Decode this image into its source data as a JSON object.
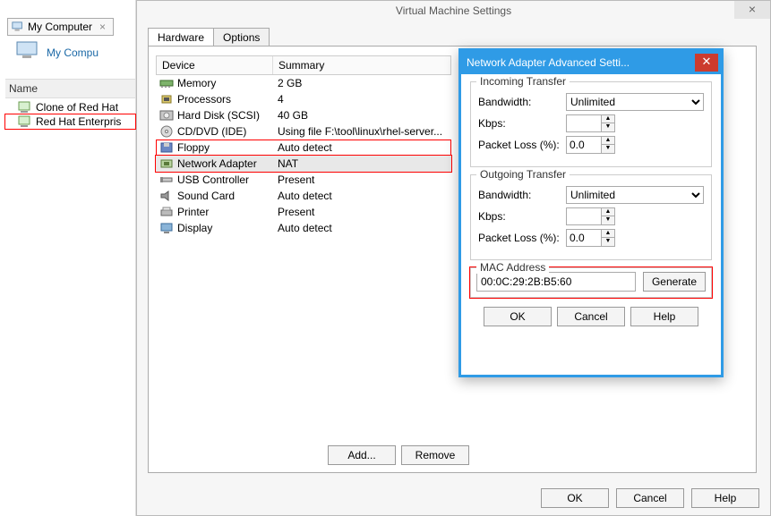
{
  "sidebar": {
    "tab_label": "My Computer",
    "title": "My Compu",
    "name_header": "Name",
    "items": [
      {
        "label": "Clone of Red Hat"
      },
      {
        "label": "Red Hat Enterpris"
      }
    ]
  },
  "dialog": {
    "title": "Virtual Machine Settings",
    "tabs": {
      "hardware": "Hardware",
      "options": "Options"
    },
    "columns": {
      "device": "Device",
      "summary": "Summary"
    },
    "devices": [
      {
        "name": "Memory",
        "summary": "2 GB",
        "icon": "memory"
      },
      {
        "name": "Processors",
        "summary": "4",
        "icon": "cpu"
      },
      {
        "name": "Hard Disk (SCSI)",
        "summary": "40 GB",
        "icon": "hdd"
      },
      {
        "name": "CD/DVD (IDE)",
        "summary": "Using file F:\\tool\\linux\\rhel-server...",
        "icon": "cd"
      },
      {
        "name": "Floppy",
        "summary": "Auto detect",
        "icon": "floppy"
      },
      {
        "name": "Network Adapter",
        "summary": "NAT",
        "icon": "nic"
      },
      {
        "name": "USB Controller",
        "summary": "Present",
        "icon": "usb"
      },
      {
        "name": "Sound Card",
        "summary": "Auto detect",
        "icon": "sound"
      },
      {
        "name": "Printer",
        "summary": "Present",
        "icon": "printer"
      },
      {
        "name": "Display",
        "summary": "Auto detect",
        "icon": "display"
      }
    ],
    "buttons": {
      "add": "Add...",
      "remove": "Remove",
      "ok": "OK",
      "cancel": "Cancel",
      "help": "Help"
    }
  },
  "adv": {
    "title": "Network Adapter Advanced Setti...",
    "incoming": {
      "legend": "Incoming Transfer",
      "bandwidth_label": "Bandwidth:",
      "bandwidth_value": "Unlimited",
      "kbps_label": "Kbps:",
      "kbps_value": "",
      "loss_label": "Packet Loss (%):",
      "loss_value": "0.0"
    },
    "outgoing": {
      "legend": "Outgoing Transfer",
      "bandwidth_label": "Bandwidth:",
      "bandwidth_value": "Unlimited",
      "kbps_label": "Kbps:",
      "kbps_value": "",
      "loss_label": "Packet Loss (%):",
      "loss_value": "0.0"
    },
    "mac": {
      "legend": "MAC Address",
      "value": "00:0C:29:2B:B5:60",
      "generate": "Generate"
    },
    "buttons": {
      "ok": "OK",
      "cancel": "Cancel",
      "help": "Help"
    }
  }
}
